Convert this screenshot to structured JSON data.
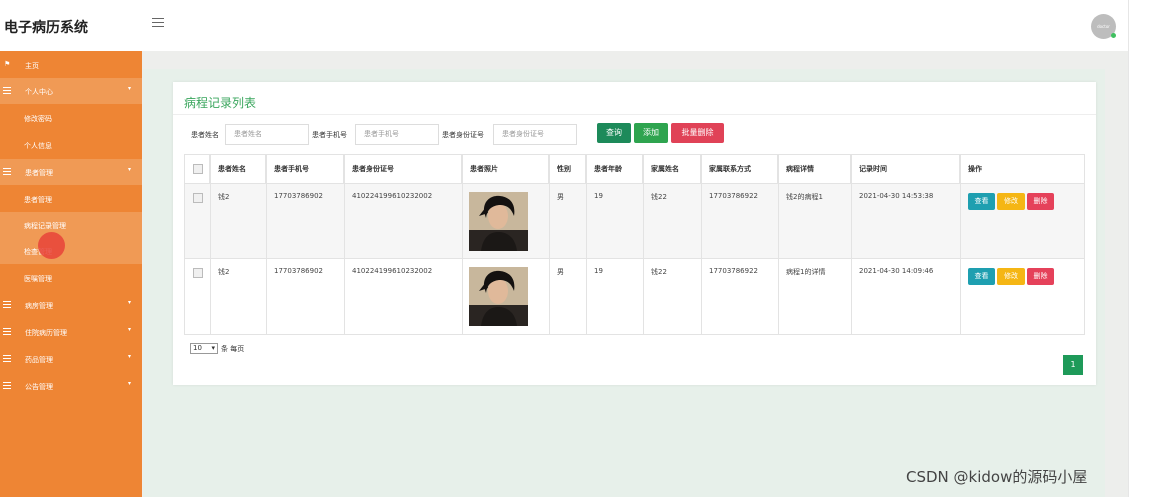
{
  "app": {
    "title": "电子病历系统",
    "avatar_text": "doctor"
  },
  "sidebar": {
    "items": [
      {
        "label": "主页"
      },
      {
        "label": "个人中心"
      },
      {
        "label": "修改密码"
      },
      {
        "label": "个人信息"
      },
      {
        "label": "患者管理"
      },
      {
        "label": "患者管理"
      },
      {
        "label": "病程记录管理"
      },
      {
        "label": "检查管理"
      },
      {
        "label": "医嘱管理"
      },
      {
        "label": "病房管理"
      },
      {
        "label": "住院病历管理"
      },
      {
        "label": "药品管理"
      },
      {
        "label": "公告管理"
      }
    ]
  },
  "page": {
    "title": "病程记录列表"
  },
  "search": {
    "name_label": "患者姓名",
    "name_placeholder": "患者姓名",
    "phone_label": "患者手机号",
    "phone_placeholder": "患者手机号",
    "id_label": "患者身份证号",
    "id_placeholder": "患者身份证号"
  },
  "buttons": {
    "query": "查询",
    "add": "添加",
    "batch_delete": "批量删除"
  },
  "table": {
    "headers": [
      "患者姓名",
      "患者手机号",
      "患者身份证号",
      "患者照片",
      "性别",
      "患者年龄",
      "家属姓名",
      "家属联系方式",
      "病程详情",
      "记录时间",
      "操作"
    ],
    "rows": [
      {
        "name": "钱2",
        "phone": "17703786902",
        "id_card": "410224199610232002",
        "gender": "男",
        "age": "19",
        "family_name": "钱22",
        "family_phone": "17703786922",
        "detail": "钱2的病程1",
        "time": "2021-04-30 14:53:38"
      },
      {
        "name": "钱2",
        "phone": "17703786902",
        "id_card": "410224199610232002",
        "gender": "男",
        "age": "19",
        "family_name": "钱22",
        "family_phone": "17703786922",
        "detail": "病程1的详情",
        "time": "2021-04-30 14:09:46"
      }
    ],
    "actions": {
      "view": "查看",
      "edit": "修改",
      "delete": "删除"
    }
  },
  "pagination": {
    "page_size": "10",
    "per_page_text": "条 每页",
    "current_page": "1"
  },
  "watermark": "CSDN @kidow的源码小屋",
  "colors": {
    "sidebar": "#ee8534",
    "accent_green": "#3aa65d",
    "delete_red": "#e04257"
  }
}
